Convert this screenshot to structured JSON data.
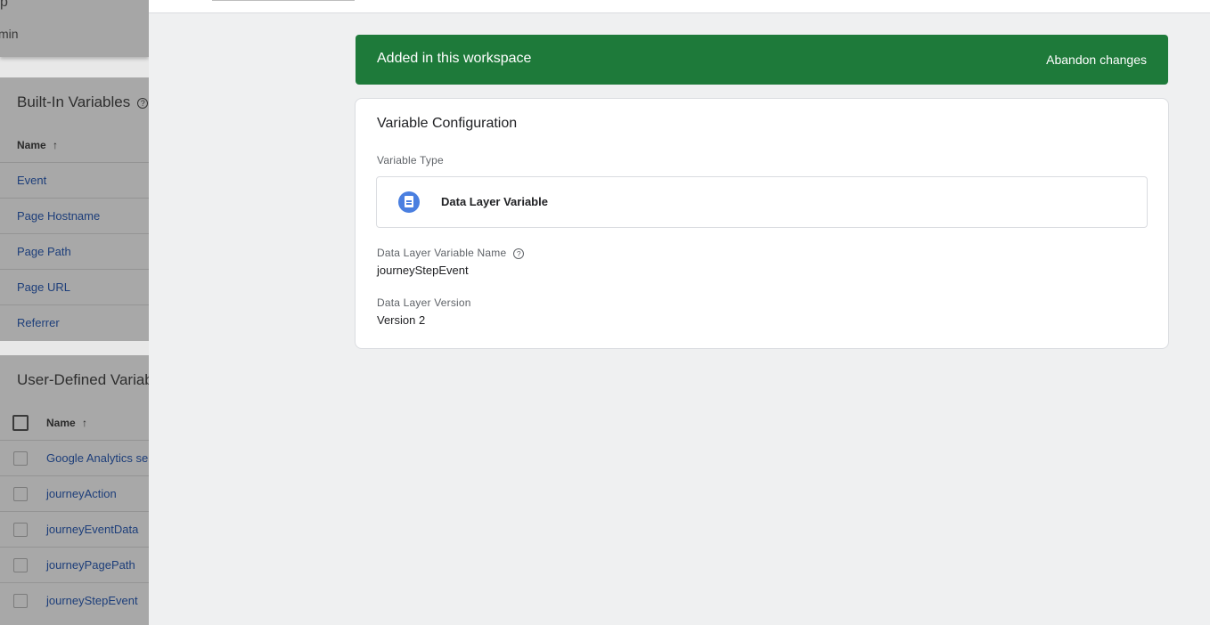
{
  "background": {
    "top_crumb": "min",
    "builtin": {
      "title": "Built-In Variables",
      "name_header": "Name",
      "sort_arrow": "↑",
      "help_symbol": "?",
      "items": [
        "Event",
        "Page Hostname",
        "Page Path",
        "Page URL",
        "Referrer"
      ]
    },
    "user_defined": {
      "title": "User-Defined Variab",
      "name_header": "Name",
      "sort_arrow": "↑",
      "items": [
        "Google Analytics se",
        "journeyAction",
        "journeyEventData",
        "journeyPagePath",
        "journeyStepEvent"
      ]
    }
  },
  "banner": {
    "message": "Added in this workspace",
    "action": "Abandon changes",
    "color": "#1e7a3a"
  },
  "config": {
    "title": "Variable Configuration",
    "type_label": "Variable Type",
    "type_value": "Data Layer Variable",
    "type_icon": "document-icon",
    "name_label": "Data Layer Variable Name",
    "name_value": "journeyStepEvent",
    "help_symbol": "?",
    "version_label": "Data Layer Version",
    "version_value": "Version 2"
  }
}
